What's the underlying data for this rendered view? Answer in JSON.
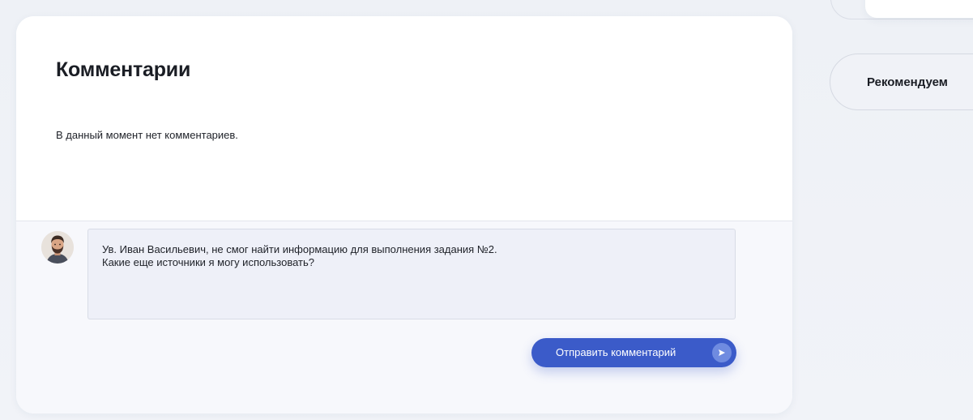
{
  "comments": {
    "title": "Комментарии",
    "empty_message": "В данный момент нет комментариев.",
    "input_value": "Ув. Иван Васильевич, не смог найти информацию для выполнения задания №2.\nКакие еще источники я могу использовать?",
    "send_label": "Отправить комментарий",
    "send_icon": "send-arrow-icon"
  },
  "sidebar": {
    "recommend_label": "Рекомендуем"
  },
  "colors": {
    "accent": "#3b5bc9",
    "page_background": "#eef1f6",
    "card_background": "#ffffff",
    "input_background": "#eef0f8"
  }
}
